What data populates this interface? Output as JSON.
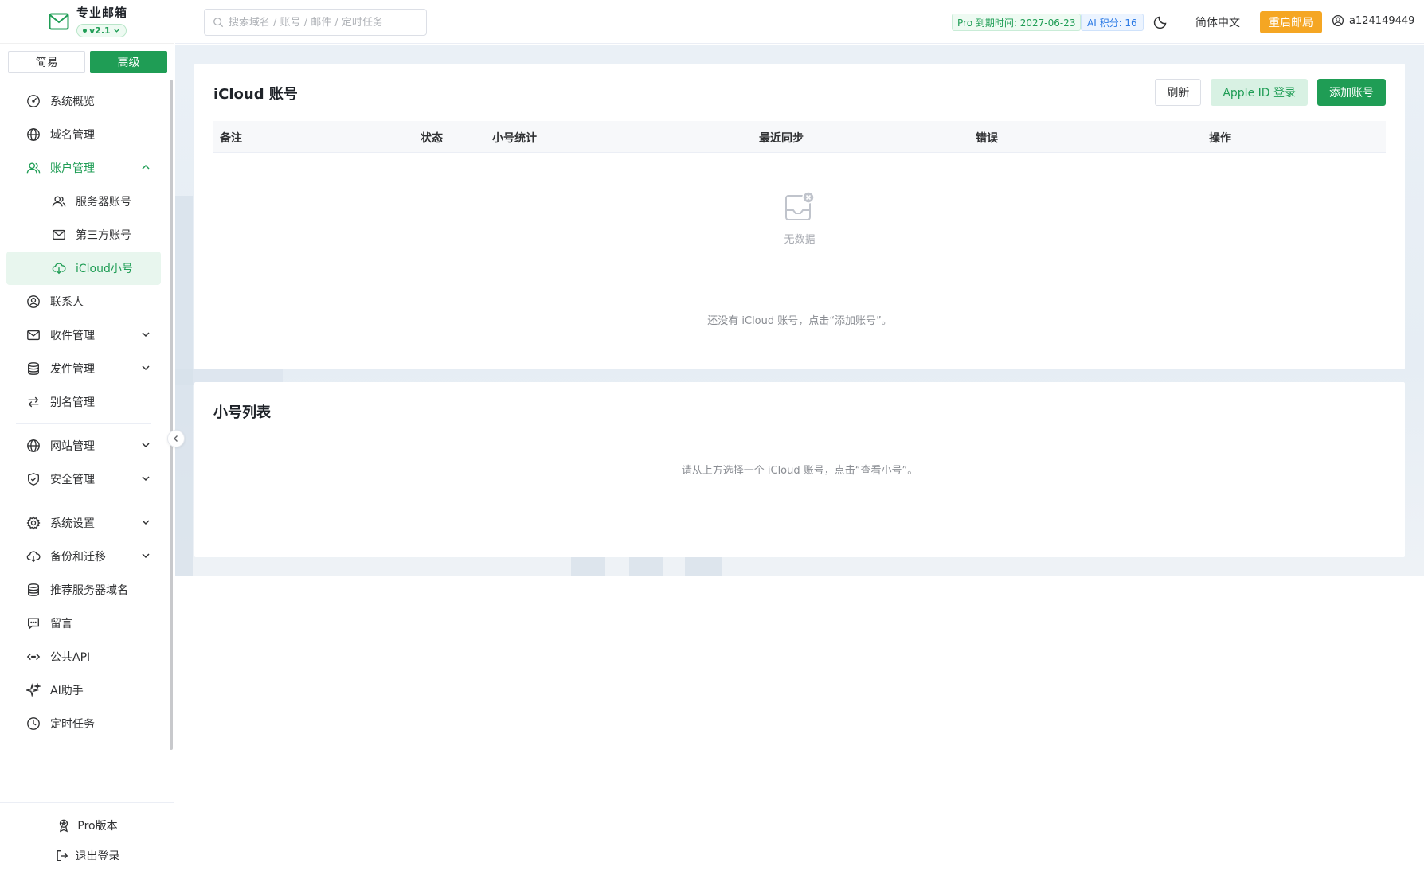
{
  "brand": {
    "title": "专业邮箱",
    "version": "v2.1"
  },
  "mode": {
    "simple": "简易",
    "advanced": "高级",
    "selected": "高级"
  },
  "menu": {
    "overview": "系统概览",
    "domains": "域名管理",
    "accounts": "账户管理",
    "server_accounts": "服务器账号",
    "third_party": "第三方账号",
    "icloud": "iCloud小号",
    "contacts": "联系人",
    "inbox": "收件管理",
    "outbox": "发件管理",
    "alias": "别名管理",
    "website": "网站管理",
    "security": "安全管理",
    "settings": "系统设置",
    "backup": "备份和迁移",
    "recommend": "推荐服务器域名",
    "message": "留言",
    "api": "公共API",
    "ai": "AI助手",
    "scheduled": "定时任务"
  },
  "footer": {
    "pro": "Pro版本",
    "logout": "退出登录"
  },
  "header": {
    "search_placeholder": "搜索域名 / 账号 / 邮件 / 定时任务",
    "pro_tag": "Pro 到期时间: 2027-06-23",
    "ai_tag": "AI 积分: 16",
    "language": "简体中文",
    "restart": "重启邮局",
    "username": "a124149449"
  },
  "icloud_card": {
    "title": "iCloud 账号",
    "refresh": "刷新",
    "apple_login": "Apple ID 登录",
    "add_account": "添加账号",
    "columns": [
      "备注",
      "状态",
      "小号统计",
      "最近同步",
      "错误",
      "操作"
    ],
    "empty_text": "无数据",
    "hint": "还没有 iCloud 账号，点击“添加账号”。"
  },
  "alias_card": {
    "title": "小号列表",
    "hint": "请从上方选择一个 iCloud 账号，点击“查看小号”。"
  },
  "colors": {
    "accent": "#1f9d55",
    "warning": "#f5a623",
    "info": "#2d7be5"
  }
}
